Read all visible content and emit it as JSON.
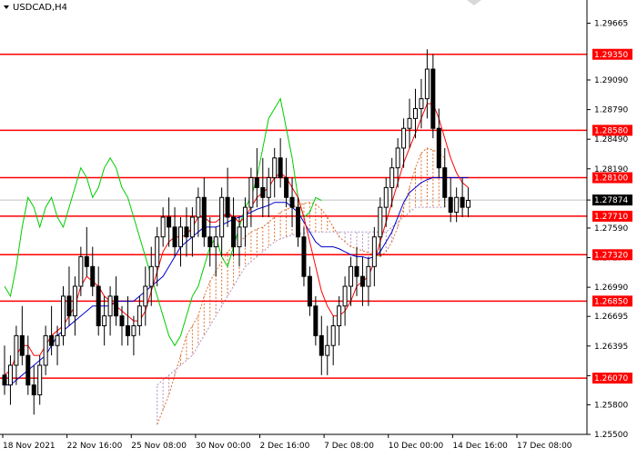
{
  "chart_data": {
    "type": "candlestick",
    "symbol_label": "USDCAD,H4",
    "colors": {
      "candle": "#000000",
      "level_line": "#ff0000",
      "tenkan": "#ff0000",
      "kijun": "#0000cc",
      "chikou": "#00cc00",
      "cloud_up": "#e07030",
      "cloud_down": "#b090c0",
      "current_price_line": "#c0c0c0"
    },
    "y_range": [
      1.255,
      1.299
    ],
    "y_ticks": [
      "1.29665",
      "1.29090",
      "1.28790",
      "1.28490",
      "1.28190",
      "1.27874",
      "1.27590",
      "1.27290",
      "1.26990",
      "1.26695",
      "1.26395",
      "1.26095",
      "1.25800",
      "1.25500"
    ],
    "x_labels": [
      "18 Nov 2021",
      "22 Nov 16:00",
      "25 Nov 08:00",
      "30 Nov 00:00",
      "2 Dec 16:00",
      "7 Dec 08:00",
      "10 Dec 00:00",
      "14 Dec 16:00",
      "17 Dec 08:00"
    ],
    "levels": [
      {
        "price": 1.2935,
        "label": "1.29350"
      },
      {
        "price": 1.2858,
        "label": "1.28580"
      },
      {
        "price": 1.281,
        "label": "1.28100"
      },
      {
        "price": 1.2771,
        "label": "1.27710"
      },
      {
        "price": 1.2732,
        "label": "1.27320"
      },
      {
        "price": 1.2685,
        "label": "1.26850"
      },
      {
        "price": 1.2607,
        "label": "1.26070"
      }
    ],
    "current_price": {
      "price": 1.27874,
      "label": "1.27874"
    },
    "candles": [
      [
        1.261,
        1.264,
        1.259,
        1.26
      ],
      [
        1.26,
        1.263,
        1.258,
        1.262
      ],
      [
        1.262,
        1.266,
        1.26,
        1.265
      ],
      [
        1.265,
        1.268,
        1.262,
        1.263
      ],
      [
        1.263,
        1.265,
        1.259,
        1.26
      ],
      [
        1.26,
        1.262,
        1.257,
        1.259
      ],
      [
        1.259,
        1.263,
        1.258,
        1.262
      ],
      [
        1.262,
        1.266,
        1.261,
        1.265
      ],
      [
        1.265,
        1.268,
        1.263,
        1.264
      ],
      [
        1.264,
        1.266,
        1.262,
        1.265
      ],
      [
        1.265,
        1.27,
        1.264,
        1.269
      ],
      [
        1.269,
        1.272,
        1.266,
        1.267
      ],
      [
        1.267,
        1.271,
        1.265,
        1.27
      ],
      [
        1.27,
        1.274,
        1.269,
        1.273
      ],
      [
        1.273,
        1.276,
        1.271,
        1.272
      ],
      [
        1.272,
        1.274,
        1.269,
        1.27
      ],
      [
        1.27,
        1.272,
        1.265,
        1.266
      ],
      [
        1.266,
        1.269,
        1.264,
        1.267
      ],
      [
        1.267,
        1.27,
        1.265,
        1.269
      ],
      [
        1.269,
        1.271,
        1.266,
        1.267
      ],
      [
        1.267,
        1.268,
        1.264,
        1.266
      ],
      [
        1.266,
        1.269,
        1.264,
        1.265
      ],
      [
        1.265,
        1.267,
        1.263,
        1.266
      ],
      [
        1.266,
        1.269,
        1.265,
        1.268
      ],
      [
        1.268,
        1.272,
        1.266,
        1.27
      ],
      [
        1.27,
        1.274,
        1.268,
        1.272
      ],
      [
        1.272,
        1.276,
        1.27,
        1.275
      ],
      [
        1.275,
        1.278,
        1.274,
        1.277
      ],
      [
        1.277,
        1.279,
        1.274,
        1.276
      ],
      [
        1.276,
        1.278,
        1.273,
        1.274
      ],
      [
        1.274,
        1.277,
        1.272,
        1.276
      ],
      [
        1.276,
        1.278,
        1.273,
        1.275
      ],
      [
        1.275,
        1.278,
        1.273,
        1.277
      ],
      [
        1.277,
        1.28,
        1.275,
        1.279
      ],
      [
        1.279,
        1.281,
        1.274,
        1.275
      ],
      [
        1.275,
        1.277,
        1.272,
        1.274
      ],
      [
        1.274,
        1.276,
        1.271,
        1.275
      ],
      [
        1.275,
        1.28,
        1.273,
        1.279
      ],
      [
        1.279,
        1.282,
        1.276,
        1.277
      ],
      [
        1.277,
        1.279,
        1.273,
        1.274
      ],
      [
        1.274,
        1.277,
        1.272,
        1.276
      ],
      [
        1.276,
        1.279,
        1.274,
        1.278
      ],
      [
        1.278,
        1.282,
        1.276,
        1.281
      ],
      [
        1.281,
        1.284,
        1.278,
        1.28
      ],
      [
        1.28,
        1.283,
        1.277,
        1.279
      ],
      [
        1.279,
        1.282,
        1.277,
        1.281
      ],
      [
        1.281,
        1.284,
        1.279,
        1.283
      ],
      [
        1.283,
        1.285,
        1.28,
        1.281
      ],
      [
        1.281,
        1.283,
        1.278,
        1.279
      ],
      [
        1.279,
        1.281,
        1.276,
        1.278
      ],
      [
        1.278,
        1.279,
        1.274,
        1.275
      ],
      [
        1.275,
        1.276,
        1.27,
        1.271
      ],
      [
        1.271,
        1.272,
        1.267,
        1.268
      ],
      [
        1.268,
        1.269,
        1.264,
        1.265
      ],
      [
        1.265,
        1.267,
        1.261,
        1.263
      ],
      [
        1.263,
        1.266,
        1.261,
        1.264
      ],
      [
        1.264,
        1.267,
        1.262,
        1.266
      ],
      [
        1.266,
        1.269,
        1.264,
        1.268
      ],
      [
        1.268,
        1.271,
        1.266,
        1.27
      ],
      [
        1.27,
        1.273,
        1.268,
        1.272
      ],
      [
        1.272,
        1.274,
        1.269,
        1.271
      ],
      [
        1.271,
        1.273,
        1.268,
        1.27
      ],
      [
        1.27,
        1.273,
        1.268,
        1.272
      ],
      [
        1.272,
        1.276,
        1.27,
        1.275
      ],
      [
        1.275,
        1.279,
        1.273,
        1.278
      ],
      [
        1.278,
        1.281,
        1.276,
        1.28
      ],
      [
        1.28,
        1.283,
        1.278,
        1.282
      ],
      [
        1.282,
        1.285,
        1.28,
        1.284
      ],
      [
        1.284,
        1.287,
        1.282,
        1.286
      ],
      [
        1.286,
        1.289,
        1.284,
        1.287
      ],
      [
        1.287,
        1.29,
        1.285,
        1.288
      ],
      [
        1.288,
        1.291,
        1.286,
        1.289
      ],
      [
        1.289,
        1.294,
        1.287,
        1.292
      ],
      [
        1.292,
        1.2935,
        1.285,
        1.286
      ],
      [
        1.286,
        1.288,
        1.281,
        1.282
      ],
      [
        1.282,
        1.284,
        1.278,
        1.279
      ],
      [
        1.279,
        1.281,
        1.2765,
        1.2775
      ],
      [
        1.2775,
        1.28,
        1.2765,
        1.279
      ],
      [
        1.279,
        1.281,
        1.277,
        1.278
      ],
      [
        1.278,
        1.28,
        1.277,
        1.2787
      ]
    ],
    "tenkan": [
      1.261,
      1.2615,
      1.263,
      1.264,
      1.264,
      1.263,
      1.263,
      1.264,
      1.265,
      1.2655,
      1.266,
      1.267,
      1.268,
      1.27,
      1.271,
      1.2705,
      1.27,
      1.269,
      1.2685,
      1.268,
      1.2675,
      1.267,
      1.2665,
      1.2665,
      1.2675,
      1.2695,
      1.2715,
      1.2735,
      1.2745,
      1.275,
      1.275,
      1.2752,
      1.276,
      1.277,
      1.277,
      1.2765,
      1.2765,
      1.277,
      1.2775,
      1.277,
      1.2765,
      1.277,
      1.278,
      1.279,
      1.2795,
      1.28,
      1.281,
      1.2815,
      1.281,
      1.28,
      1.279,
      1.277,
      1.2745,
      1.272,
      1.2695,
      1.268,
      1.267,
      1.267,
      1.2675,
      1.2685,
      1.27,
      1.2705,
      1.271,
      1.2725,
      1.2745,
      1.2765,
      1.2785,
      1.2805,
      1.2825,
      1.284,
      1.2855,
      1.287,
      1.2885,
      1.2885,
      1.287,
      1.285,
      1.283,
      1.2815,
      1.2805,
      1.28
    ],
    "kijun": [
      1.26,
      1.26,
      1.2605,
      1.261,
      1.2615,
      1.262,
      1.2625,
      1.263,
      1.264,
      1.265,
      1.2655,
      1.266,
      1.2665,
      1.267,
      1.2675,
      1.268,
      1.268,
      1.268,
      1.268,
      1.2685,
      1.2685,
      1.2685,
      1.2685,
      1.269,
      1.2695,
      1.27,
      1.2705,
      1.271,
      1.272,
      1.273,
      1.274,
      1.2745,
      1.275,
      1.2755,
      1.276,
      1.276,
      1.276,
      1.2762,
      1.2765,
      1.2768,
      1.277,
      1.2772,
      1.2775,
      1.2778,
      1.278,
      1.2782,
      1.2785,
      1.2785,
      1.2785,
      1.278,
      1.2775,
      1.2765,
      1.2755,
      1.2745,
      1.274,
      1.274,
      1.274,
      1.2738,
      1.2735,
      1.2732,
      1.273,
      1.273,
      1.2728,
      1.273,
      1.2735,
      1.2745,
      1.2755,
      1.277,
      1.2785,
      1.2795,
      1.28,
      1.2805,
      1.2808,
      1.281,
      1.281,
      1.281,
      1.281,
      1.281,
      1.281,
      1.281
    ],
    "chikou": [
      1.27,
      1.269,
      1.272,
      1.276,
      1.279,
      1.278,
      1.276,
      1.278,
      1.279,
      1.277,
      1.276,
      1.278,
      1.28,
      1.282,
      1.281,
      1.279,
      1.28,
      1.282,
      1.283,
      1.282,
      1.28,
      1.279,
      1.277,
      1.275,
      1.273,
      1.271,
      1.269,
      1.267,
      1.265,
      1.264,
      1.265,
      1.267,
      1.269,
      1.27,
      1.272,
      1.274,
      1.275,
      1.273,
      1.272,
      1.274,
      1.276,
      1.278,
      1.279,
      1.281,
      1.284,
      1.287,
      1.288,
      1.289,
      1.286,
      1.283,
      1.279,
      1.277,
      1.2775,
      1.279,
      1.2787
    ],
    "span_a": [
      1.256,
      1.2575,
      1.259,
      1.261,
      1.263,
      1.265,
      1.266,
      1.267,
      1.269,
      1.2705,
      1.2715,
      1.2725,
      1.2735,
      1.274,
      1.2745,
      1.275,
      1.2755,
      1.2758,
      1.276,
      1.2765,
      1.277,
      1.2775,
      1.2778,
      1.278,
      1.2782,
      1.2784,
      1.2785,
      1.2783,
      1.2778,
      1.277,
      1.276,
      1.275,
      1.2745,
      1.274,
      1.2738,
      1.2736,
      1.2734,
      1.2732,
      1.273,
      1.2735,
      1.2745,
      1.276,
      1.278,
      1.28,
      1.282,
      1.2835,
      1.284,
      1.2838,
      1.2835,
      1.283
    ],
    "span_b": [
      1.26,
      1.2605,
      1.261,
      1.2615,
      1.262,
      1.2625,
      1.263,
      1.264,
      1.265,
      1.266,
      1.267,
      1.268,
      1.269,
      1.27,
      1.271,
      1.272,
      1.2725,
      1.273,
      1.2735,
      1.274,
      1.2745,
      1.2748,
      1.275,
      1.2752,
      1.2753,
      1.2754,
      1.2755,
      1.2755,
      1.2755,
      1.2755,
      1.2755,
      1.2755,
      1.2755,
      1.2755,
      1.2755,
      1.2755,
      1.2755,
      1.2755,
      1.2755,
      1.2755,
      1.276,
      1.2765,
      1.277,
      1.2775,
      1.278,
      1.278,
      1.278,
      1.278,
      1.278,
      1.278
    ]
  }
}
